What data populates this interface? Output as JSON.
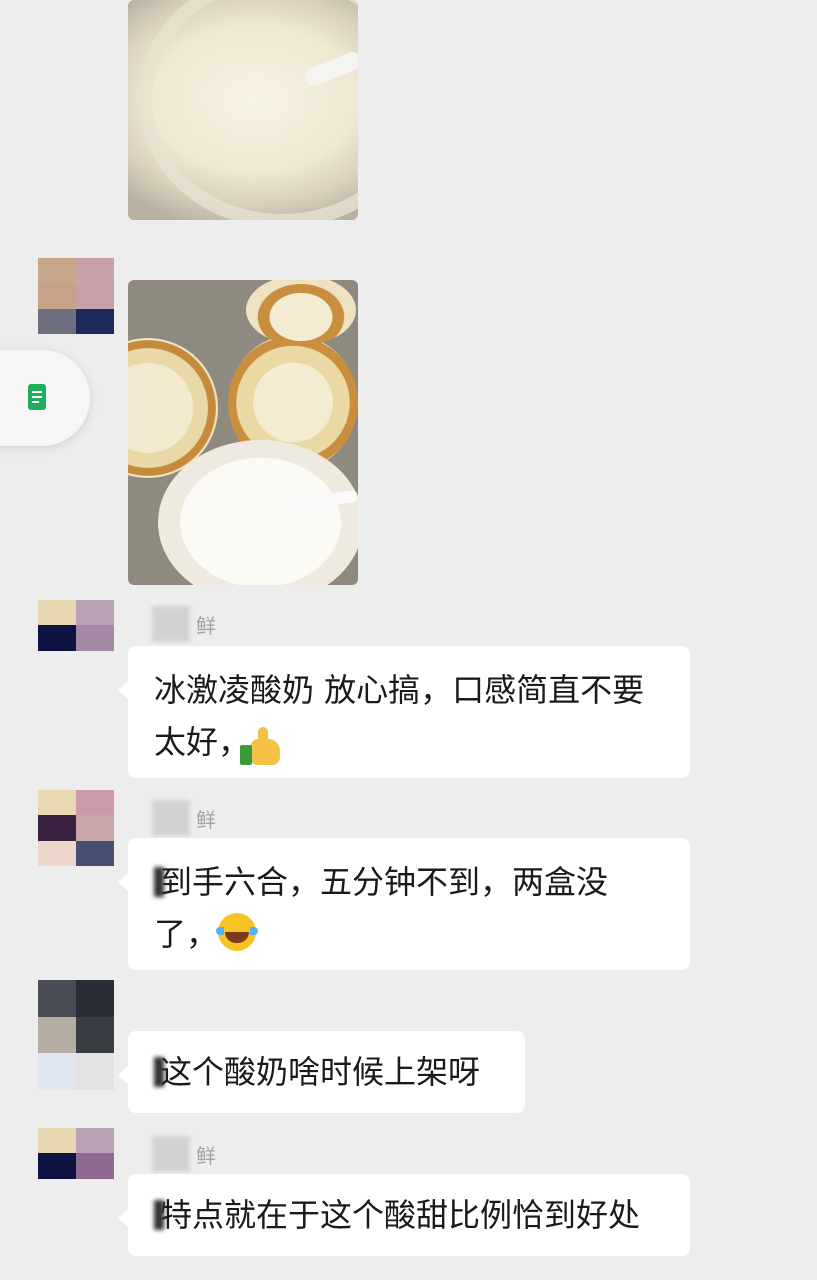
{
  "messages": [
    {
      "sender_suffix": "鲜",
      "text": "冰激凌酸奶 放心搞，口感简直不要太好，",
      "emoji": "thumbs-up"
    },
    {
      "sender_suffix": "鲜",
      "text": "到手六合，五分钟不到，两盒没了，",
      "emoji": "tears-of-joy"
    },
    {
      "sender_suffix": "",
      "text": "这个酸奶啥时候上架呀",
      "emoji": ""
    },
    {
      "sender_suffix": "鲜",
      "text": "特点就在于这个酸甜比例恰到好处",
      "emoji": ""
    }
  ],
  "icons": {
    "floating_button": "note-icon",
    "emoji_1": "thumbs-up-icon",
    "emoji_2": "tears-of-joy-icon"
  },
  "colors": {
    "background": "#ededed",
    "bubble": "#ffffff",
    "text": "#1a1a1a",
    "note_icon": "#1fae5c"
  }
}
